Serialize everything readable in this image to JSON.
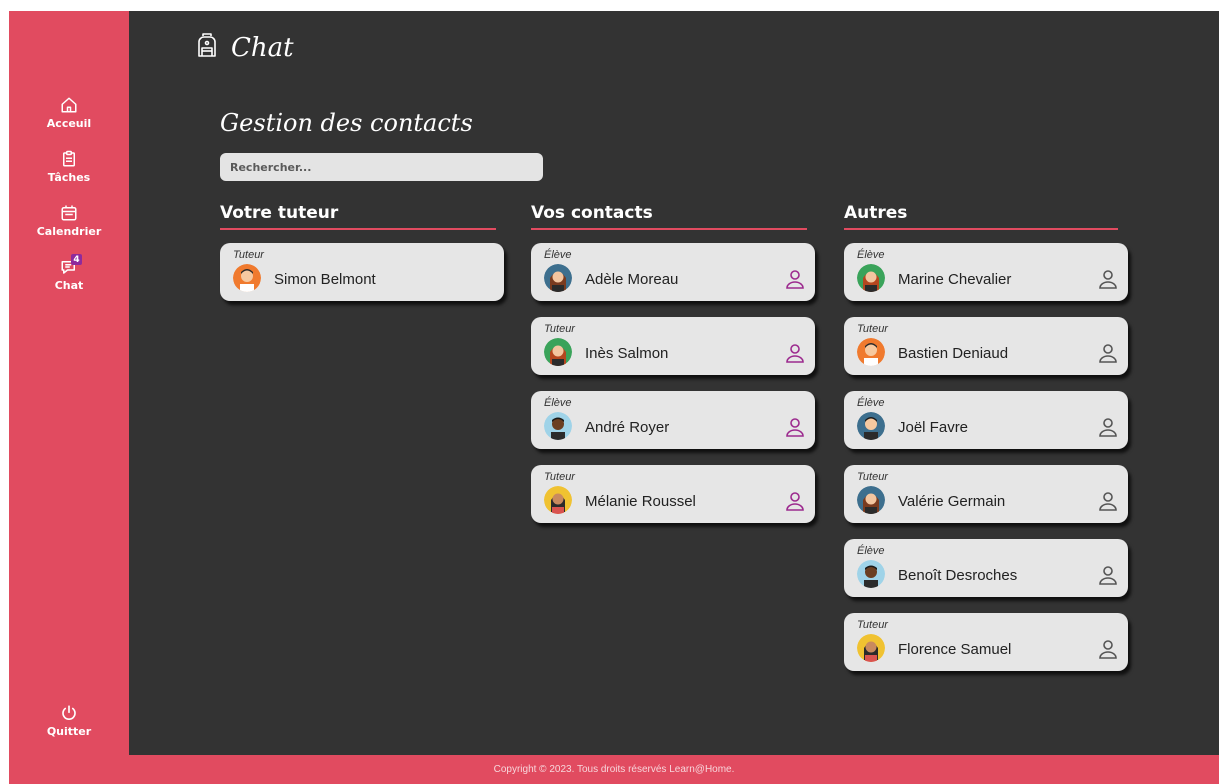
{
  "app": {
    "title": "Chat",
    "title_icon": "backpack-icon"
  },
  "colors": {
    "accent": "#e14b60",
    "background": "#333333",
    "card": "#e6e6e6",
    "contact_icon": "#9c2a8e",
    "other_icon": "#555555"
  },
  "sidebar": {
    "items": [
      {
        "label": "Acceuil",
        "icon": "home-icon"
      },
      {
        "label": "Tâches",
        "icon": "clipboard-icon"
      },
      {
        "label": "Calendrier",
        "icon": "calendar-icon"
      },
      {
        "label": "Chat",
        "icon": "chat-icon",
        "badge": "4"
      }
    ],
    "quit_label": "Quitter",
    "quit_icon": "power-icon"
  },
  "main": {
    "title": "Gestion des contacts",
    "search_placeholder": "Rechercher...",
    "columns": [
      {
        "title": "Votre tuteur",
        "cards": [
          {
            "role": "Tuteur",
            "name": "Simon Belmont",
            "avatar": "man-orange"
          }
        ]
      },
      {
        "title": "Vos contacts",
        "cards": [
          {
            "role": "Élève",
            "name": "Adèle Moreau",
            "avatar": "woman-blue"
          },
          {
            "role": "Tuteur",
            "name": "Inès Salmon",
            "avatar": "woman-green"
          },
          {
            "role": "Élève",
            "name": "André Royer",
            "avatar": "man-lightblue"
          },
          {
            "role": "Tuteur",
            "name": "Mélanie Roussel",
            "avatar": "woman-yellow"
          }
        ]
      },
      {
        "title": "Autres",
        "cards": [
          {
            "role": "Élève",
            "name": "Marine Chevalier",
            "avatar": "woman-green"
          },
          {
            "role": "Tuteur",
            "name": "Bastien Deniaud",
            "avatar": "man-orange"
          },
          {
            "role": "Élève",
            "name": "Joël Favre",
            "avatar": "man-blue"
          },
          {
            "role": "Tuteur",
            "name": "Valérie Germain",
            "avatar": "woman-blue"
          },
          {
            "role": "Élève",
            "name": "Benoît Desroches",
            "avatar": "man-lightblue"
          },
          {
            "role": "Tuteur",
            "name": "Florence Samuel",
            "avatar": "woman-yellow"
          }
        ]
      }
    ]
  },
  "footer": {
    "copyright": "Copyright © 2023. Tous droits réservés Learn@Home."
  }
}
